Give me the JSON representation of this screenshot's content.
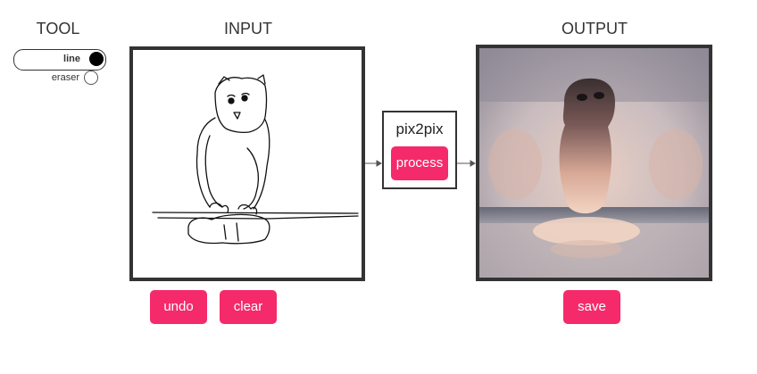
{
  "headings": {
    "tool": "TOOL",
    "input": "INPUT",
    "output": "OUTPUT"
  },
  "tools": {
    "line": {
      "label": "line",
      "selected": true
    },
    "eraser": {
      "label": "eraser",
      "selected": false
    }
  },
  "model": {
    "name": "pix2pix",
    "process_label": "process"
  },
  "buttons": {
    "undo": "undo",
    "clear": "clear",
    "save": "save"
  },
  "colors": {
    "accent": "#f52a6a",
    "frame": "#333333"
  }
}
